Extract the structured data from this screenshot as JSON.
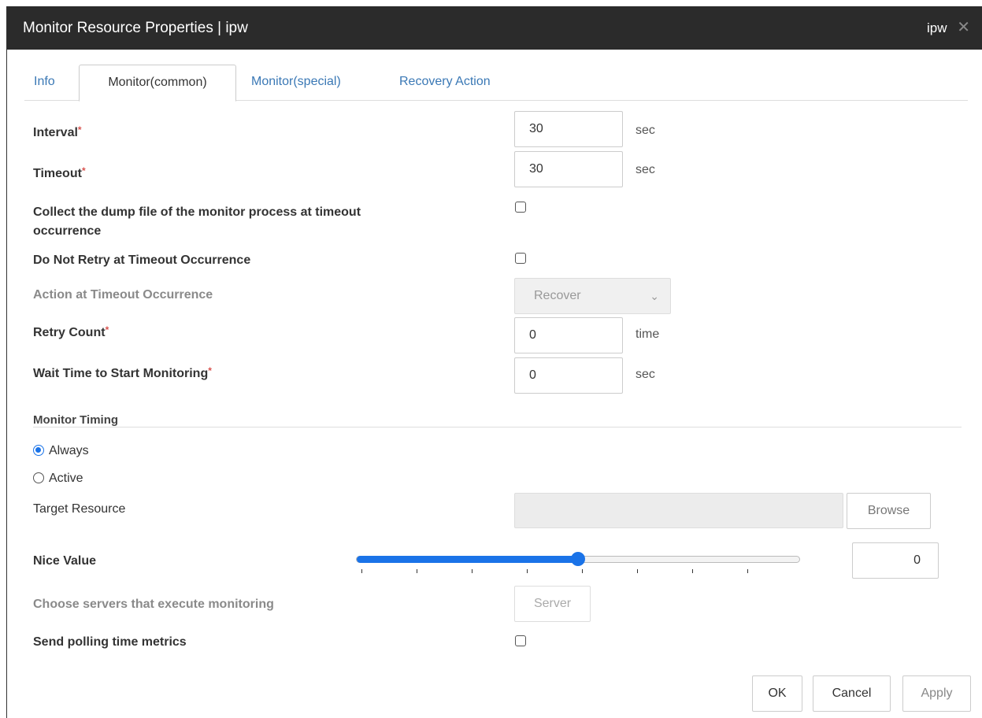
{
  "window": {
    "title": "Monitor Resource Properties | ipw",
    "right_label": "ipw",
    "close_glyph": "✕"
  },
  "tabs": [
    {
      "label": "Info",
      "active": false
    },
    {
      "label": "Monitor(common)",
      "active": true
    },
    {
      "label": "Monitor(special)",
      "active": false
    },
    {
      "label": "Recovery Action",
      "active": false
    }
  ],
  "required_mark": "*",
  "fields": {
    "interval": {
      "label": "Interval",
      "value": "30",
      "unit": "sec"
    },
    "timeout": {
      "label": "Timeout",
      "value": "30",
      "unit": "sec"
    },
    "collect_dump": {
      "label_line1": "Collect the dump file of the monitor process at timeout",
      "label_line2": "occurrence",
      "checked": false
    },
    "no_retry": {
      "label": "Do Not Retry at Timeout Occurrence",
      "checked": false
    },
    "action_timeout": {
      "label": "Action at Timeout Occurrence",
      "value": "Recover"
    },
    "retry_count": {
      "label": "Retry Count",
      "value": "0",
      "unit": "time"
    },
    "wait_time": {
      "label": "Wait Time to Start Monitoring",
      "value": "0",
      "unit": "sec"
    }
  },
  "monitor_timing": {
    "title": "Monitor Timing",
    "options": [
      {
        "label": "Always",
        "selected": true
      },
      {
        "label": "Active",
        "selected": false
      }
    ],
    "target_resource_label": "Target Resource",
    "target_resource_value": "",
    "browse_label": "Browse"
  },
  "nice": {
    "label": "Nice Value",
    "value": "0",
    "slider_fraction": 0.5
  },
  "servers": {
    "label": "Choose servers that execute monitoring",
    "button": "Server"
  },
  "polling": {
    "label": "Send polling time metrics",
    "checked": false
  },
  "footer": {
    "ok": "OK",
    "cancel": "Cancel",
    "apply": "Apply"
  },
  "colors": {
    "accent": "#1a73e8",
    "titlebar": "#2b2b2b",
    "tab_link": "#3a78b5",
    "required": "#d9534f"
  }
}
